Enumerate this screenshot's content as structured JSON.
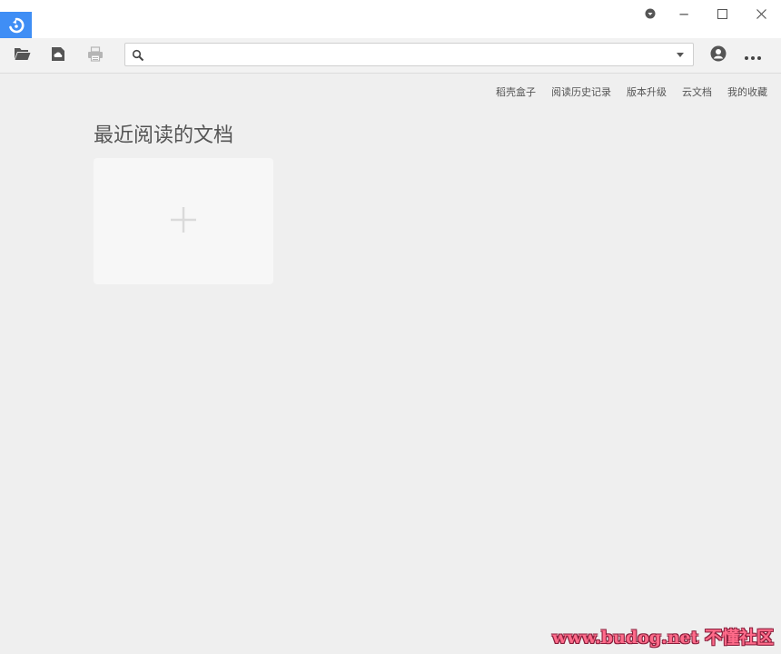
{
  "titlebar": {
    "logo_icon": "app-logo-icon",
    "accent_color": "#3f8ef5",
    "buttons": {
      "settings_icon": "settings-dot-icon",
      "minimize": "─",
      "maximize": "☐",
      "close": "✕"
    }
  },
  "toolbar": {
    "icons": [
      "open-folder-icon",
      "save-cloud-icon",
      "print-icon",
      "account-icon",
      "more-icon"
    ],
    "search": {
      "value": "",
      "placeholder": ""
    }
  },
  "topnav": {
    "items": [
      "稻壳盒子",
      "阅读历史记录",
      "版本升级",
      "云文档",
      "我的收藏"
    ]
  },
  "main": {
    "title": "最近阅读的文档",
    "add_card_symbol": "+"
  },
  "watermark": {
    "text": "www.budog.net 不懂社区"
  }
}
